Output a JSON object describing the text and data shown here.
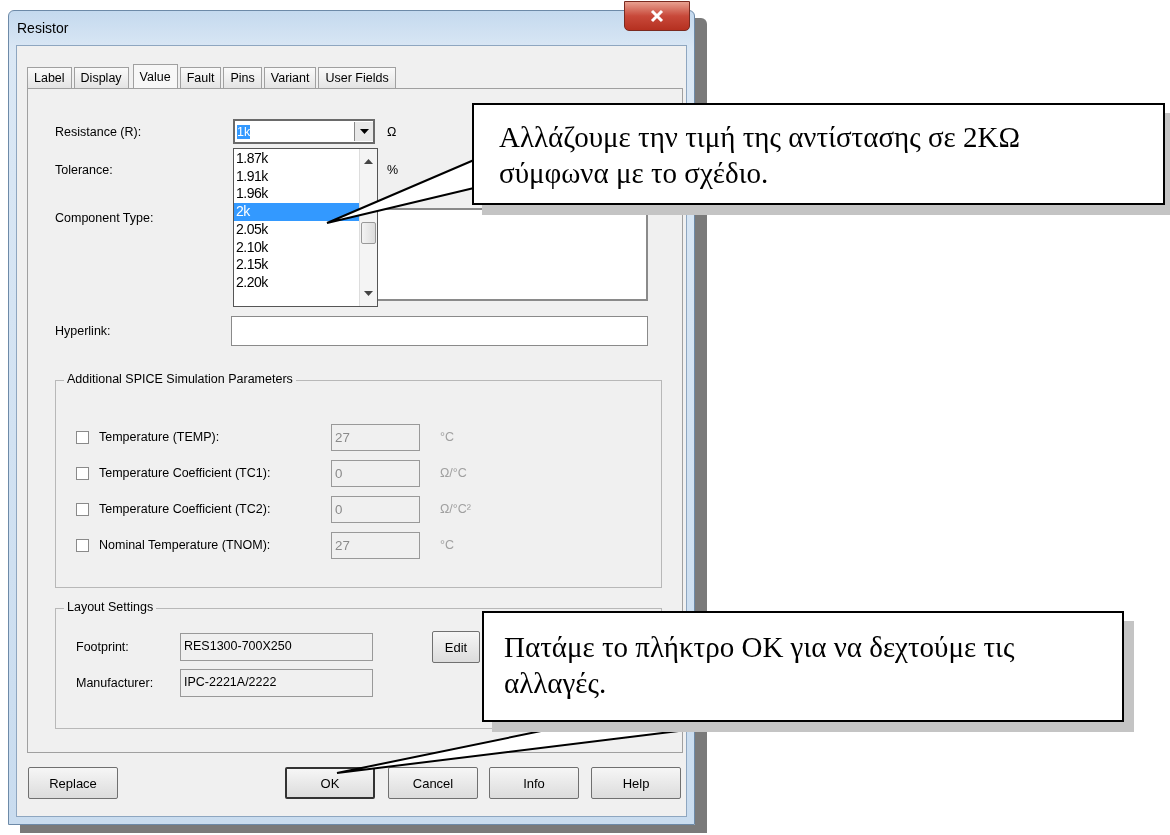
{
  "window": {
    "title": "Resistor"
  },
  "tabs": [
    {
      "label": "Label",
      "selected": false
    },
    {
      "label": "Display",
      "selected": false
    },
    {
      "label": "Value",
      "selected": true
    },
    {
      "label": "Fault",
      "selected": false
    },
    {
      "label": "Pins",
      "selected": false
    },
    {
      "label": "Variant",
      "selected": false
    },
    {
      "label": "User Fields",
      "selected": false
    }
  ],
  "value_tab": {
    "resistance": {
      "label": "Resistance (R):",
      "value": "1k",
      "unit": "Ω"
    },
    "tolerance": {
      "label": "Tolerance:",
      "unit": "%"
    },
    "component_type": {
      "label": "Component Type:"
    },
    "dropdown": {
      "items": [
        {
          "label": "1.87k",
          "selected": false
        },
        {
          "label": "1.91k",
          "selected": false
        },
        {
          "label": "1.96k",
          "selected": false
        },
        {
          "label": "2k",
          "selected": true
        },
        {
          "label": "2.05k",
          "selected": false
        },
        {
          "label": "2.10k",
          "selected": false
        },
        {
          "label": "2.15k",
          "selected": false
        },
        {
          "label": "2.20k",
          "selected": false
        }
      ]
    },
    "hyperlink": {
      "label": "Hyperlink:"
    },
    "spice": {
      "title": "Additional SPICE Simulation Parameters",
      "params": [
        {
          "label": "Temperature (TEMP):",
          "checked": false,
          "value": "27",
          "unit": "°C",
          "disabled": true
        },
        {
          "label": "Temperature Coefficient (TC1):",
          "checked": false,
          "value": "0",
          "unit": "Ω/°C",
          "disabled": true
        },
        {
          "label": "Temperature Coefficient (TC2):",
          "checked": false,
          "value": "0",
          "unit": "Ω/°C²",
          "disabled": true
        },
        {
          "label": "Nominal Temperature (TNOM):",
          "checked": false,
          "value": "27",
          "unit": "°C",
          "disabled": true
        }
      ]
    },
    "layout": {
      "title": "Layout Settings",
      "fields": [
        {
          "label": "Footprint:",
          "value": "RES1300-700X250"
        },
        {
          "label": "Manufacturer:",
          "value": "IPC-2221A/2222"
        }
      ],
      "edit_button": "Edit"
    }
  },
  "buttons": [
    {
      "label": "Replace",
      "default": false
    },
    {
      "label": "OK",
      "default": true
    },
    {
      "label": "Cancel",
      "default": false
    },
    {
      "label": "Info",
      "default": false
    },
    {
      "label": "Help",
      "default": false
    }
  ],
  "callouts": [
    {
      "text": "Αλλάζουμε την τιμή της αντίστασης σε 2ΚΩ σύμφωνα με το σχέδιο."
    },
    {
      "text": "Πατάμε το πλήκτρο ΟΚ για να δεχτούμε τις αλλαγές."
    }
  ]
}
